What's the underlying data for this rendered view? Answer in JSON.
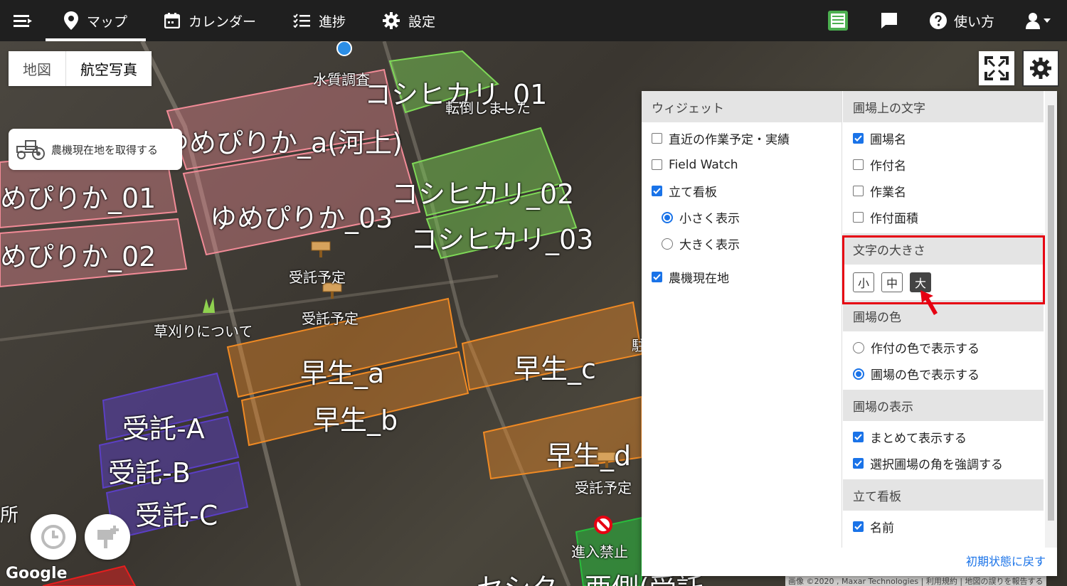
{
  "nav": {
    "items": [
      {
        "label": "マップ",
        "icon": "map-pin-icon"
      },
      {
        "label": "カレンダー",
        "icon": "calendar-icon"
      },
      {
        "label": "進捗",
        "icon": "checklist-icon"
      },
      {
        "label": "設定",
        "icon": "gear-icon"
      }
    ],
    "help_label": "使い方"
  },
  "map": {
    "type_buttons": [
      "地図",
      "航空写真"
    ],
    "tractor_button": "農機現在地を取得する",
    "google": "Google",
    "attribution": "画像 ©2020 , Maxar Technologies | 利用規約 | 地図の誤りを報告する",
    "field_labels": {
      "koshi01": "コシヒカリ_01",
      "koshi02": "コシヒカリ_02",
      "koshi03": "コシヒカリ_03",
      "yume_a": "ゆめぴりか_a(河上)",
      "yume01": "めぴりか_01",
      "yume03": "ゆめぴりか_03",
      "yume02": "めぴりか_02",
      "wase_a": "早生_a",
      "wase_b": "早生_b",
      "wase_c": "早生_c",
      "wase_d": "早生_d",
      "jutaku_a": "受託-A",
      "jutaku_b": "受託-B",
      "jutaku_c": "受託-C",
      "bottom_partial": "セシク　西側(受託"
    },
    "markers": {
      "water": "水質調査",
      "fallen": "転倒しました",
      "jutaku1": "受託予定",
      "jutaku2": "受託予定",
      "jutaku3": "受託予定",
      "kusakari": "草刈りについて",
      "noentry": "進入禁止",
      "left_edge": "所",
      "right_edge": "駐"
    }
  },
  "panel": {
    "widget": {
      "header": "ウィジェット",
      "options": [
        {
          "label": "直近の作業予定・実績",
          "checked": false
        },
        {
          "label": "Field Watch",
          "checked": false
        },
        {
          "label": "立て看板",
          "checked": true
        }
      ],
      "sign_sizes": [
        {
          "label": "小さく表示",
          "selected": true
        },
        {
          "label": "大きく表示",
          "selected": false
        }
      ],
      "tractor": {
        "label": "農機現在地",
        "checked": true
      }
    },
    "field_text": {
      "header": "圃場上の文字",
      "options": [
        {
          "label": "圃場名",
          "checked": true
        },
        {
          "label": "作付名",
          "checked": false
        },
        {
          "label": "作業名",
          "checked": false
        },
        {
          "label": "作付面積",
          "checked": false
        }
      ]
    },
    "font_size": {
      "header": "文字の大きさ",
      "buttons": [
        "小",
        "中",
        "大"
      ],
      "selected": "大"
    },
    "field_color": {
      "header": "圃場の色",
      "options": [
        {
          "label": "作付の色で表示する",
          "selected": false
        },
        {
          "label": "圃場の色で表示する",
          "selected": true
        }
      ]
    },
    "field_display": {
      "header": "圃場の表示",
      "options": [
        {
          "label": "まとめて表示する",
          "checked": true
        },
        {
          "label": "選択圃場の角を強調する",
          "checked": true
        }
      ]
    },
    "signboard": {
      "header": "立て看板",
      "options": [
        {
          "label": "名前",
          "checked": true
        }
      ]
    },
    "reset_link": "初期状態に戻す"
  },
  "colors": {
    "nav_bg": "#1f1f1f",
    "accent": "#1a73e8",
    "highlight": "#e60012",
    "field_pink": "#f28b97",
    "field_green": "#7ed957",
    "field_orange": "#f08a24",
    "field_purple": "#5b3fc4"
  }
}
